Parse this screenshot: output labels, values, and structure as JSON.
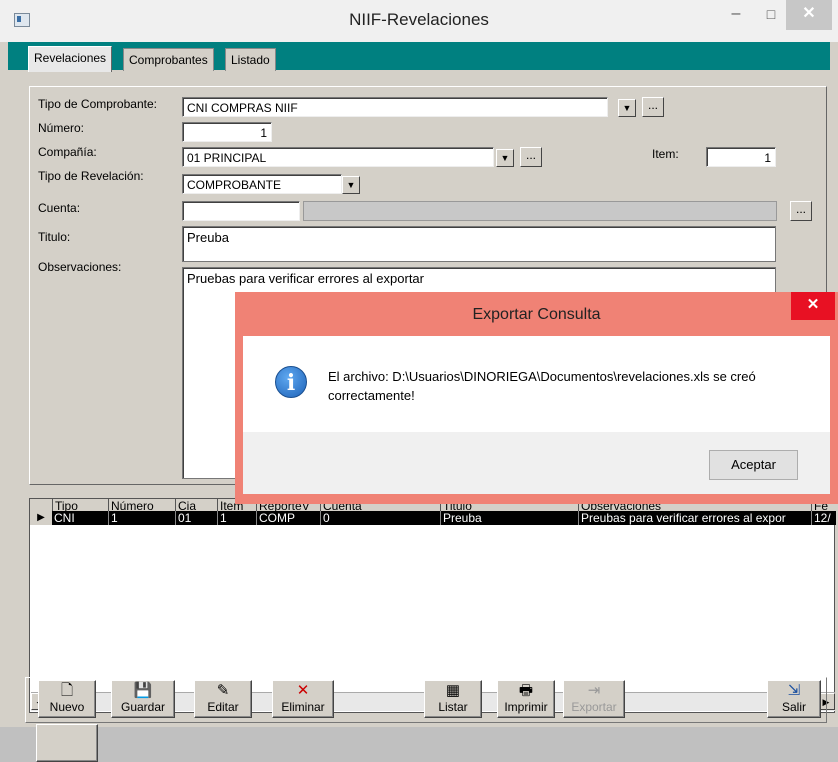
{
  "window": {
    "title": "NIIF-Revelaciones",
    "minimize": "–",
    "maximize": "□",
    "close": "✕"
  },
  "tabs": [
    {
      "label": "Revelaciones"
    },
    {
      "label": "Comprobantes"
    },
    {
      "label": "Listado"
    }
  ],
  "form": {
    "tipo_comprobante_label": "Tipo de Comprobante:",
    "tipo_comprobante_value": "CNI COMPRAS NIIF",
    "numero_label": "Número:",
    "numero_value": "1",
    "compania_label": "Compañía:",
    "compania_value": "01 PRINCIPAL",
    "item_label": "Item:",
    "item_value": "1",
    "tipo_revelacion_label": "Tipo de Revelación:",
    "tipo_revelacion_value": "COMPROBANTE",
    "cuenta_label": "Cuenta:",
    "cuenta_value": "",
    "titulo_label": "Titulo:",
    "titulo_value": "Preuba",
    "observaciones_label": "Observaciones:",
    "observaciones_value": "Pruebas para verificar errores al exportar",
    "ellipsis": "..."
  },
  "grid": {
    "headers": [
      "Tipo",
      "Número",
      "Cia",
      "Item",
      "ReporteV",
      "Cuenta",
      "Titulo",
      "Observaciones",
      "Fe"
    ],
    "row": [
      "CNI",
      "1",
      "01",
      "1",
      "COMP",
      "0",
      "Preuba",
      "Preubas para verificar errores al expor",
      "12/"
    ]
  },
  "toolbar": {
    "nuevo": "Nuevo",
    "guardar": "Guardar",
    "editar": "Editar",
    "eliminar": "Eliminar",
    "listar": "Listar",
    "imprimir": "Imprimir",
    "exportar": "Exportar",
    "salir": "Salir"
  },
  "dialog": {
    "title": "Exportar Consulta",
    "message": "El archivo: D:\\Usuarios\\DINORIEGA\\Documentos\\revelaciones.xls se creó correctamente!",
    "ok_label": "Aceptar",
    "close": "✕"
  }
}
